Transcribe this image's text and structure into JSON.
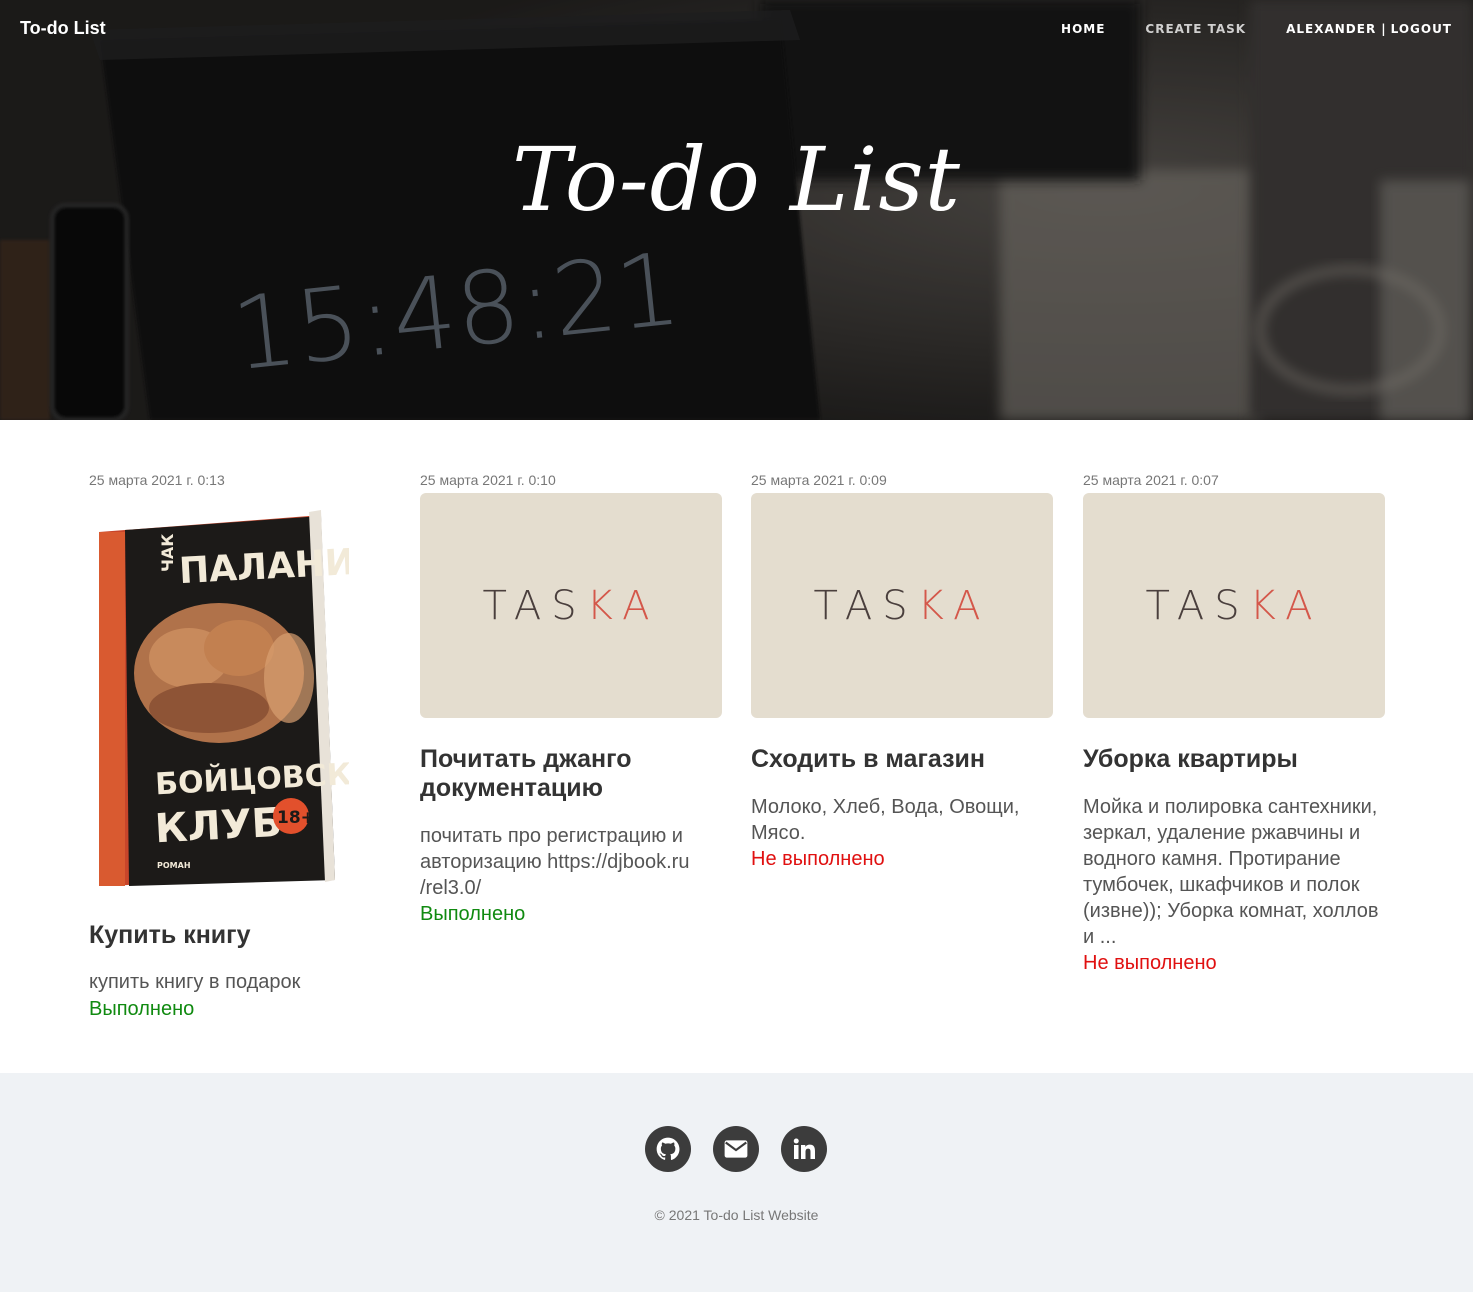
{
  "navbar": {
    "brand": "To-do List",
    "home": "HOME",
    "create_task": "CREATE TASK",
    "user": "ALEXANDER",
    "separator": "|",
    "logout": "LOGOUT"
  },
  "hero": {
    "title": "To-do List",
    "clock_text": "15:48:21"
  },
  "tasks": [
    {
      "date": "25 марта 2021 г. 0:13",
      "image": "book-cover",
      "title": "Купить книгу",
      "description": "купить книгу в подарок",
      "status": "Выполнено",
      "book": {
        "author_first": "ЧАК",
        "author_last": "ПАЛАНИК",
        "title_line1": "БОЙЦОВСКИЙ",
        "title_line2": "КЛУБ",
        "age": "18+",
        "genre": "РОМАН"
      }
    },
    {
      "date": "25 марта 2021 г. 0:10",
      "image": "taska-logo",
      "title": "Почитать джанго документацию",
      "description": "почитать про регистрацию и авторизацию https://djbook.ru /rel3.0/",
      "status": "Выполнено"
    },
    {
      "date": "25 марта 2021 г. 0:09",
      "image": "taska-logo",
      "title": "Сходить в магазин",
      "description": "Молоко, Хлеб, Вода, Овощи, Мясо.",
      "status": "Не выполнено"
    },
    {
      "date": "25 марта 2021 г. 0:07",
      "image": "taska-logo",
      "title": "Уборка квартиры",
      "description": "Мойка и полировка сантехники, зеркал, удаление ржавчины и водного камня. Протирание тумбочек, шкафчиков и полок (извне)); Уборка комнат, холлов и ...",
      "status": "Не выполнено"
    }
  ],
  "taska_logo": {
    "part1": "TAS",
    "part2": "KA"
  },
  "footer": {
    "icons": [
      "github-icon",
      "email-icon",
      "linkedin-icon"
    ],
    "copyright": "© 2021 To-do List Website"
  },
  "colors": {
    "done": "#108a10",
    "not_done": "#e01010",
    "footer_bg": "#eff2f5",
    "card_placeholder_bg": "#e4ddcf"
  }
}
